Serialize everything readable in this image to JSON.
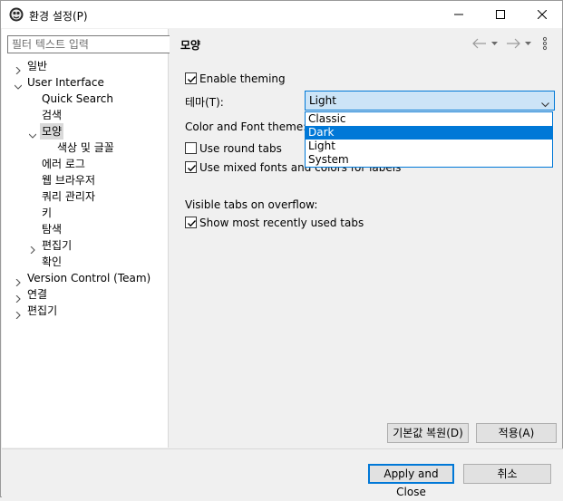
{
  "window": {
    "title": "환경 설정(P)"
  },
  "filter": {
    "placeholder": "필터 텍스트 입력"
  },
  "tree": {
    "general": "일반",
    "user_interface": "User Interface",
    "quick_search": "Quick Search",
    "search": "검색",
    "appearance": "모양",
    "colors_fonts": "색상 및 글꼴",
    "error_log": "에러 로그",
    "web_browser": "웹 브라우저",
    "query_manager": "쿼리 관리자",
    "keys": "키",
    "explore": "탐색",
    "editors_sub": "편집기",
    "confirm": "확인",
    "version_control": "Version Control (Team)",
    "connection": "연결",
    "editors": "편집기"
  },
  "page": {
    "title": "모양",
    "enable_theming": "Enable theming",
    "theme_label": "테마(T):",
    "theme_value": "Light",
    "color_font_theme_label": "Color and Font theme:",
    "use_round_tabs": "Use round tabs",
    "use_mixed_fonts": "Use mixed fonts and colors for labels",
    "visible_tabs_label": "Visible tabs on overflow:",
    "show_recent_tabs": "Show most recently used tabs",
    "restore_defaults": "기본값 복원(D)",
    "apply": "적용(A)"
  },
  "theme_options": [
    "Classic",
    "Dark",
    "Light",
    "System"
  ],
  "theme_highlighted": "Dark",
  "checks": {
    "enable_theming": true,
    "use_round_tabs": false,
    "use_mixed_fonts": true,
    "show_recent_tabs": true
  },
  "footer": {
    "apply_close": "Apply and Close",
    "cancel": "취소"
  },
  "colors": {
    "accent": "#0078d7",
    "combo_bg": "#cce4f7",
    "panel": "#f0f0f0"
  }
}
